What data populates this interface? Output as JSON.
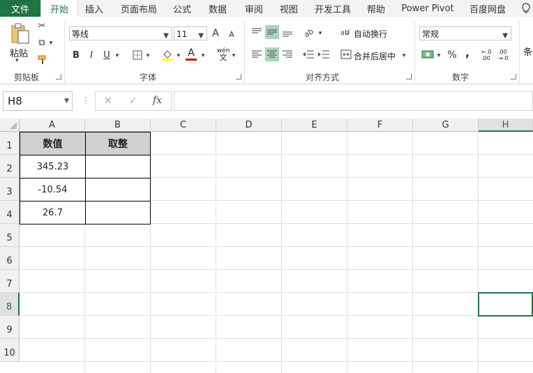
{
  "tabs": {
    "file": "文件",
    "items": [
      "开始",
      "插入",
      "页面布局",
      "公式",
      "数据",
      "审阅",
      "视图",
      "开发工具",
      "帮助",
      "Power Pivot",
      "百度网盘"
    ]
  },
  "ribbon": {
    "clipboard": {
      "paste": "粘贴",
      "label": "剪贴板"
    },
    "font": {
      "name": "等线",
      "size": "11",
      "bold": "B",
      "italic": "I",
      "underline": "U",
      "grow": "A",
      "shrink": "A",
      "color_a": "A",
      "pinyin": "wén",
      "pinyin_sub": "文",
      "label": "字体"
    },
    "align": {
      "wrap": "自动换行",
      "merge": "合并后居中",
      "label": "对齐方式"
    },
    "number": {
      "format": "常规",
      "percent": "%",
      "comma": ",",
      "inc": "←.0",
      "inc2": ".00",
      "dec": ".00",
      "dec2": "→.0",
      "label": "数字"
    },
    "styles": {
      "label": "条"
    }
  },
  "formula_bar": {
    "namebox": "H8",
    "fx": "fx",
    "cancel": "✕",
    "enter": "✓",
    "value": ""
  },
  "sheet": {
    "columns": [
      "A",
      "B",
      "C",
      "D",
      "E",
      "F",
      "G",
      "H"
    ],
    "rows": [
      "1",
      "2",
      "3",
      "4",
      "5",
      "6",
      "7",
      "8",
      "9",
      "10"
    ],
    "headers": [
      "数值",
      "取整"
    ],
    "values": [
      "345.23",
      "-10.54",
      "26.7"
    ]
  },
  "colors": {
    "accent": "#217346",
    "header_fill": "#d0d0d0"
  }
}
